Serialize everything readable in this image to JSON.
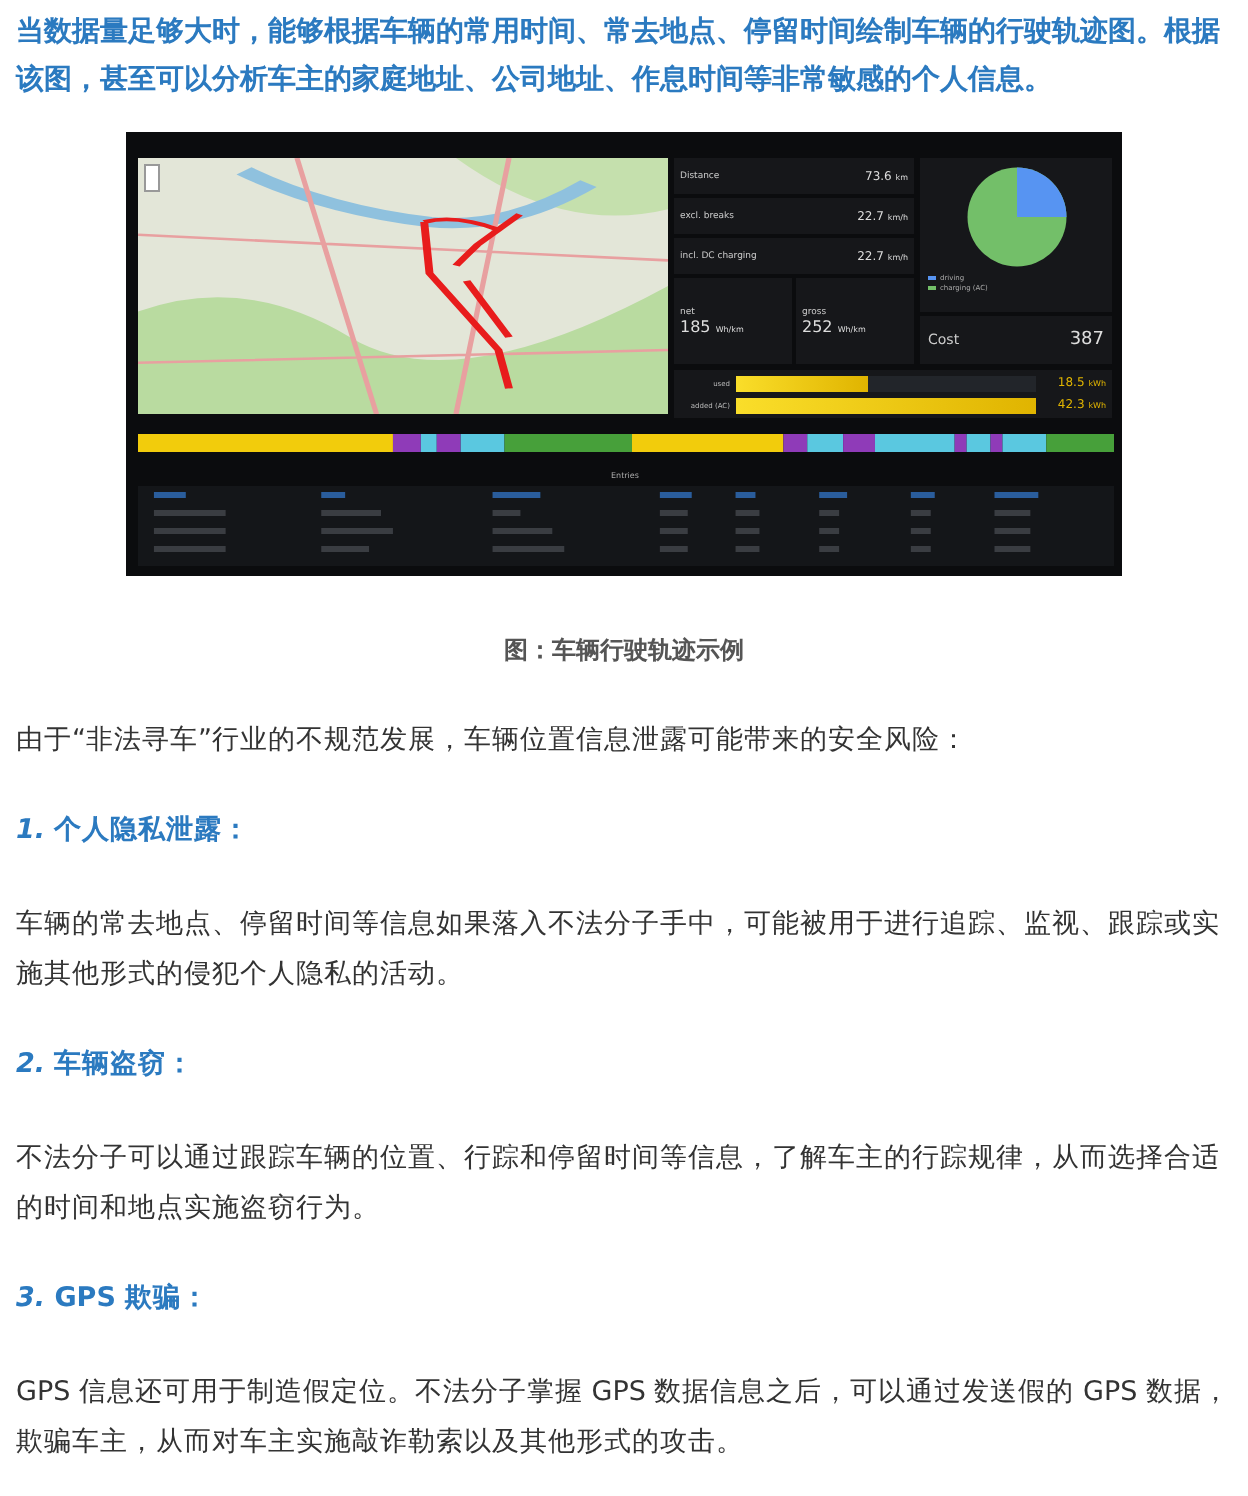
{
  "intro": "当数据量足够大时，能够根据车辆的常用时间、常去地点、停留时间绘制车辆的行驶轨迹图。根据该图，甚至可以分析车主的家庭地址、公司地址、作息时间等非常敏感的个人信息。",
  "dashboard": {
    "stats": [
      {
        "label": "Distance",
        "value": "73.6",
        "unit": "km"
      },
      {
        "label": "excl. breaks",
        "value": "22.7",
        "unit": "km/h"
      },
      {
        "label": "incl. DC charging",
        "value": "22.7",
        "unit": "km/h"
      }
    ],
    "consumption": [
      {
        "label": "net",
        "value": "185",
        "unit": "Wh/km"
      },
      {
        "label": "gross",
        "value": "252",
        "unit": "Wh/km"
      }
    ],
    "legend": [
      {
        "label": "driving",
        "color": "#5794f2"
      },
      {
        "label": "charging (AC)",
        "color": "#73bf69"
      }
    ],
    "cost": {
      "label": "Cost",
      "value": "387"
    },
    "energy": [
      {
        "label": "used",
        "value": "18.5",
        "unit": "kWh",
        "level": 0.44
      },
      {
        "label": "added (AC)",
        "value": "42.3",
        "unit": "kWh",
        "level": 1
      }
    ],
    "table_title": "Entries"
  },
  "caption": "图：车辆行驶轨迹示例",
  "lead": "由于“非法寻车”行业的不规范发展，车辆位置信息泄露可能带来的安全风险：",
  "risks": [
    {
      "number": "1.",
      "title": "个人隐私泄露：",
      "text": "车辆的常去地点、停留时间等信息如果落入不法分子手中，可能被用于进行追踪、监视、跟踪或实施其他形式的侵犯个人隐私的活动。"
    },
    {
      "number": "2.",
      "title": "车辆盗窃：",
      "text": "不法分子可以通过跟踪车辆的位置、行踪和停留时间等信息，了解车主的行踪规律，从而选择合适的时间和地点实施盗窃行为。"
    },
    {
      "number": "3.",
      "title": "GPS 欺骗：",
      "text": "GPS 信息还可用于制造假定位。不法分子掌握 GPS 数据信息之后，可以通过发送假的 GPS 数据，欺骗车主，从而对车主实施敲诈勒索以及其他形式的攻击。"
    }
  ]
}
